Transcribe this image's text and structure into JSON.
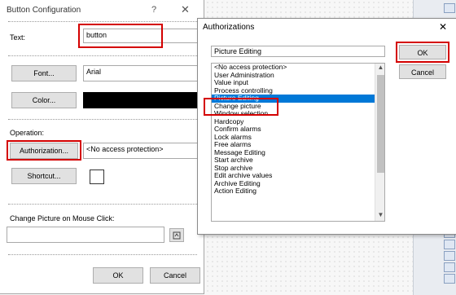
{
  "button_config": {
    "title": "Button Configuration",
    "help_glyph": "?",
    "close_glyph": "✕",
    "text_label": "Text:",
    "text_value": "button",
    "font_button": "Font...",
    "font_value": "Arial",
    "color_button": "Color...",
    "color_value": "#000000",
    "operation_label": "Operation:",
    "authorization_button": "Authorization...",
    "authorization_value": "<No access protection>",
    "shortcut_button": "Shortcut...",
    "change_picture_label": "Change Picture on Mouse Click:",
    "change_picture_value": "",
    "ok_button": "OK",
    "cancel_button": "Cancel"
  },
  "authorizations": {
    "title": "Authorizations",
    "close_glyph": "✕",
    "selected_value": "Picture Editing",
    "ok_button": "OK",
    "cancel_button": "Cancel",
    "items": [
      "<No access protection>",
      "User Administration",
      "Value input",
      "Process controlling",
      "Picture Editing",
      "Change picture",
      "Window selection",
      "Hardcopy",
      "Confirm alarms",
      "Lock alarms",
      "Free alarms",
      "Message Editing",
      "Start archive",
      "Stop archive",
      "Edit archive values",
      "Archive Editing",
      "Action Editing"
    ],
    "selected_index": 4
  },
  "colors": {
    "selection": "#0078d7",
    "highlight_box": "#d40000"
  }
}
